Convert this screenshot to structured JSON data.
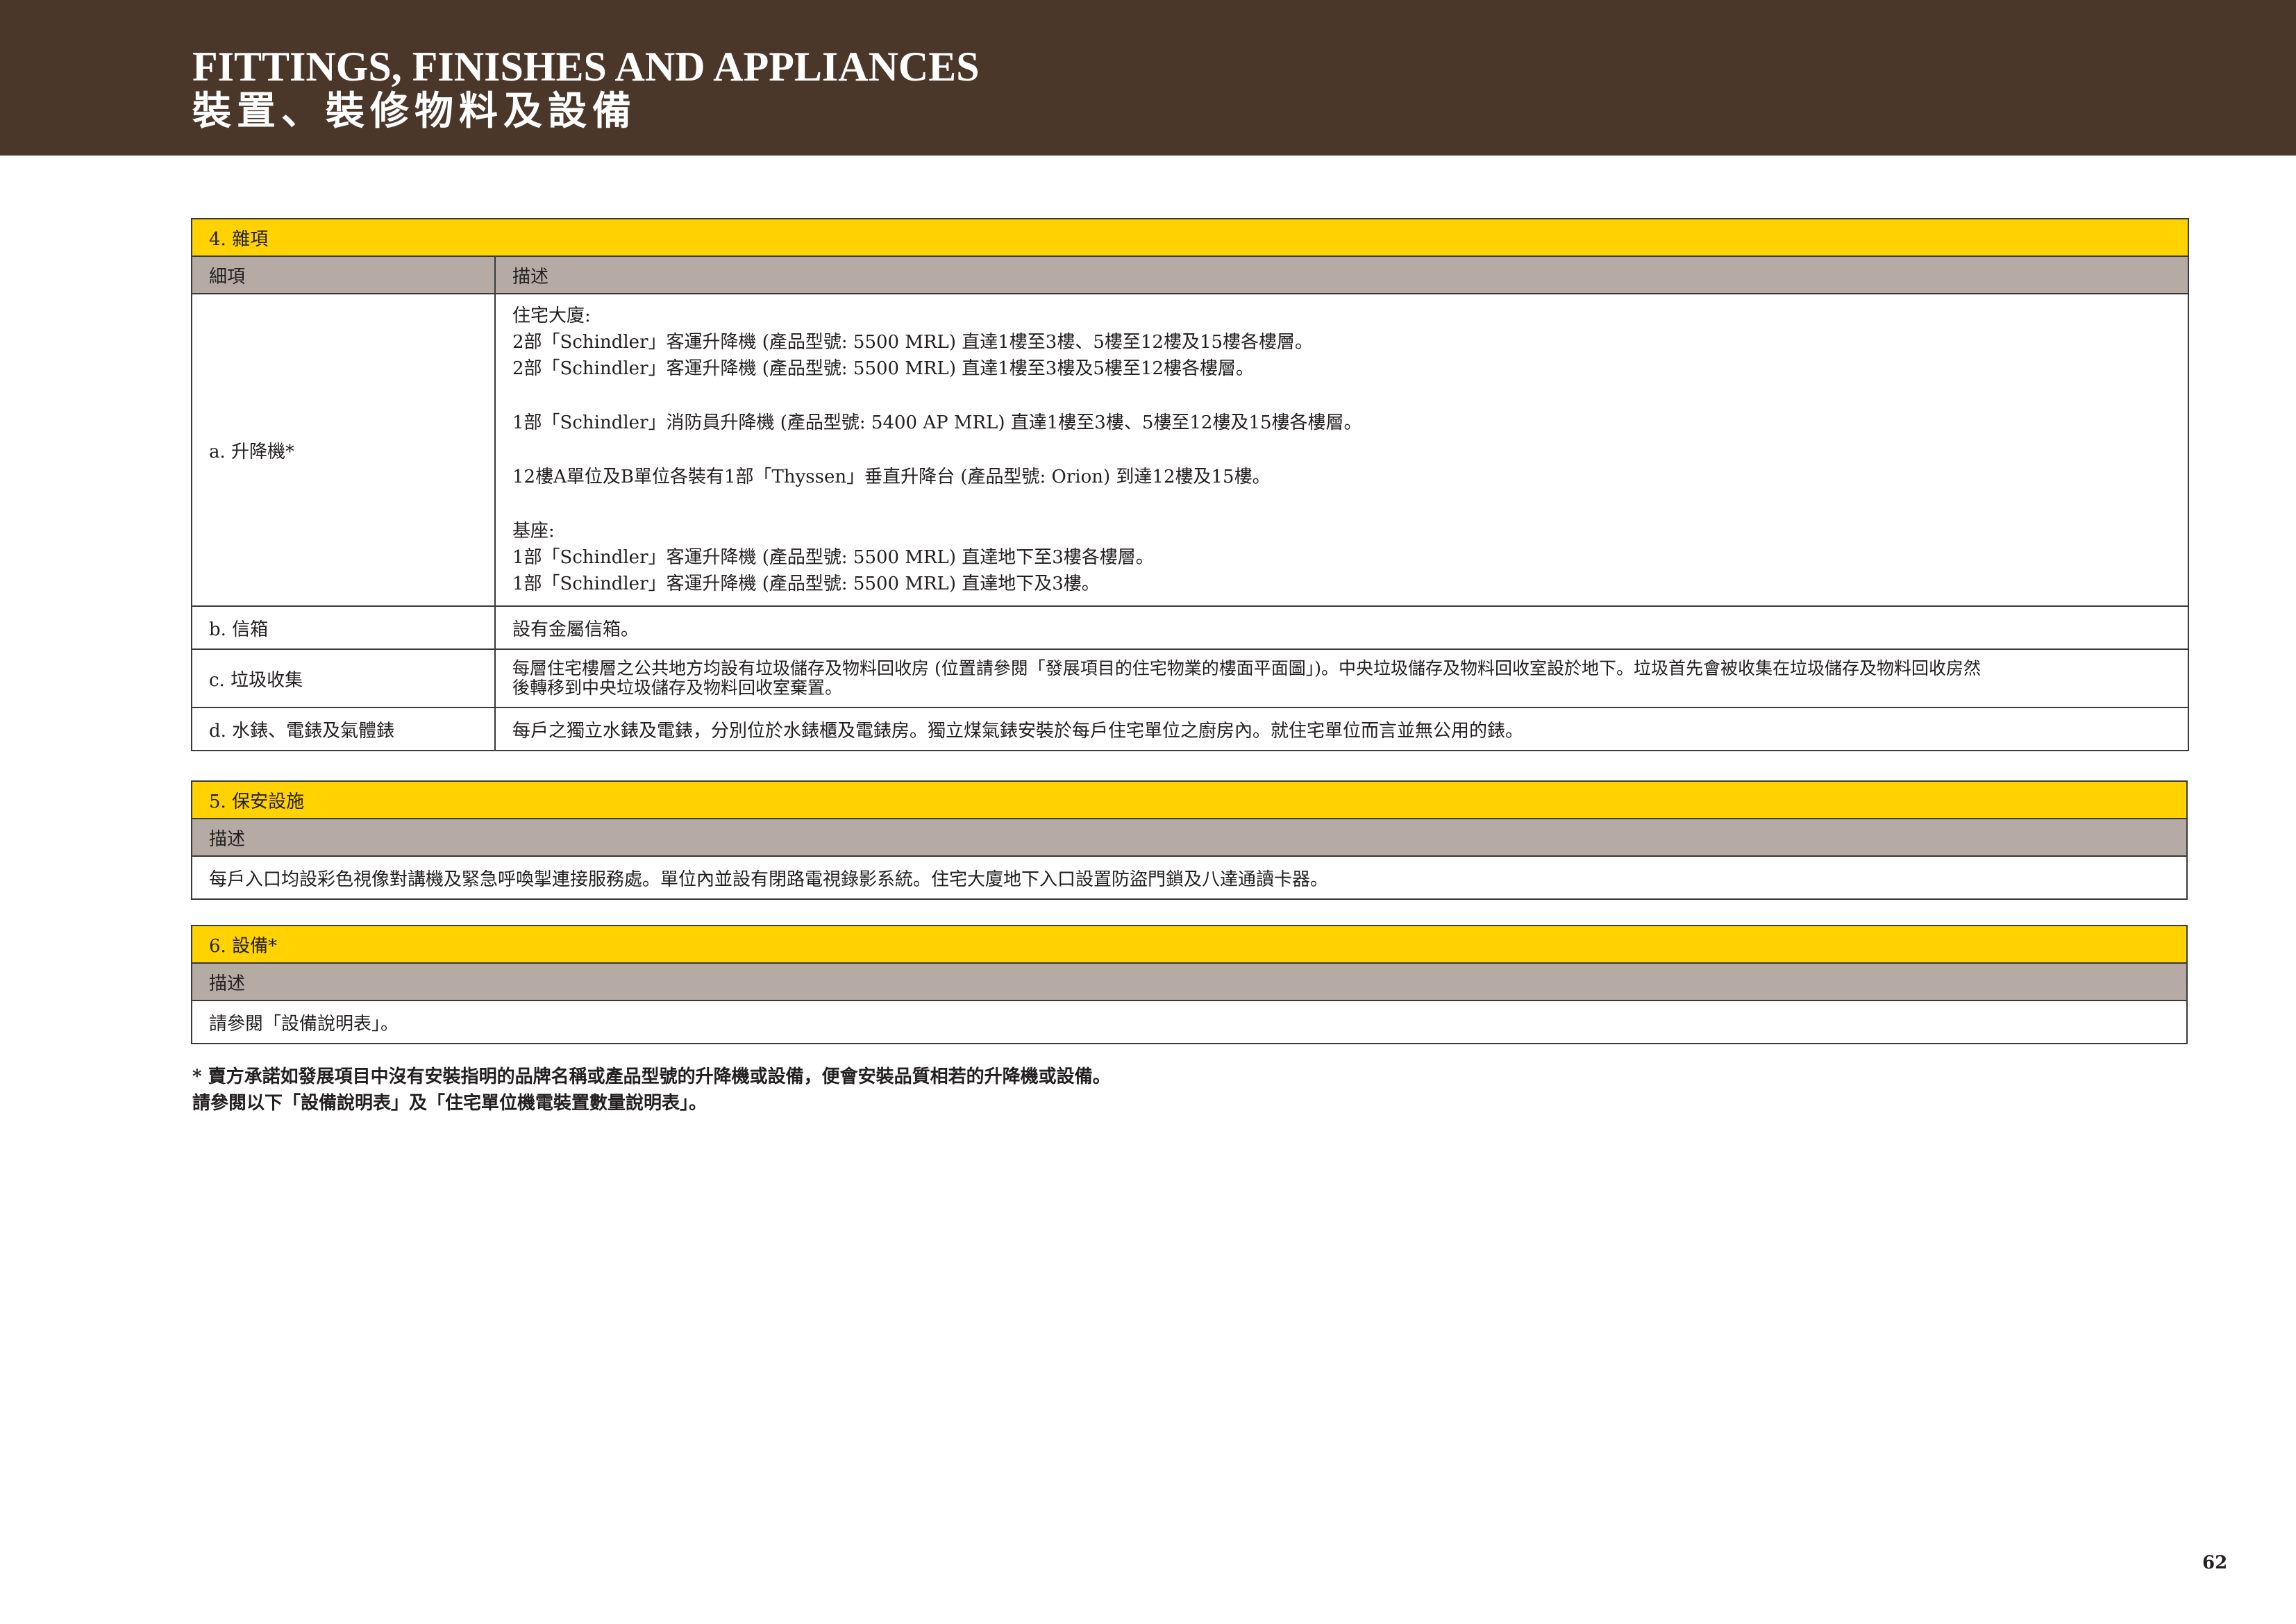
{
  "header": {
    "title_en": "FITTINGS, FINISHES AND APPLIANCES",
    "title_zh": "裝置、裝修物料及設備"
  },
  "section4": {
    "title": "4.  雜項",
    "col_item": "細項",
    "col_desc": "描述",
    "rows": [
      {
        "item": "a.  升降機*",
        "lines": [
          "住宅大廈:",
          "2部「Schindler」客運升降機 (產品型號: 5500 MRL) 直達1樓至3樓、5樓至12樓及15樓各樓層。",
          "2部「Schindler」客運升降機 (產品型號: 5500 MRL) 直達1樓至3樓及5樓至12樓各樓層。",
          "",
          "1部「Schindler」消防員升降機 (產品型號: 5400 AP MRL) 直達1樓至3樓、5樓至12樓及15樓各樓層。",
          "",
          "12樓A單位及B單位各裝有1部「Thyssen」垂直升降台 (產品型號: Orion) 到達12樓及15樓。",
          "",
          "基座:",
          "1部「Schindler」客運升降機 (產品型號: 5500 MRL) 直達地下至3樓各樓層。",
          "1部「Schindler」客運升降機 (產品型號: 5500 MRL) 直達地下及3樓。"
        ]
      },
      {
        "item": "b.  信箱",
        "lines": [
          "設有金屬信箱。"
        ]
      },
      {
        "item": "c.  垃圾收集",
        "lines": [
          "每層住宅樓層之公共地方均設有垃圾儲存及物料回收房 (位置請參閱「發展項目的住宅物業的樓面平面圖」)。中央垃圾儲存及物料回收室設於地下。垃圾首先會被收集在垃圾儲存及物料回收房然",
          "後轉移到中央垃圾儲存及物料回收室棄置。"
        ]
      },
      {
        "item": "d.  水錶、電錶及氣體錶",
        "lines": [
          "每戶之獨立水錶及電錶，分別位於水錶櫃及電錶房。獨立煤氣錶安裝於每戶住宅單位之廚房內。就住宅單位而言並無公用的錶。"
        ]
      }
    ]
  },
  "section5": {
    "title": "5.  保安設施",
    "col_desc": "描述",
    "desc": "每戶入口均設彩色視像對講機及緊急呼喚掣連接服務處。單位內並設有閉路電視錄影系統。住宅大廈地下入口設置防盜門鎖及八達通讀卡器。"
  },
  "section6": {
    "title": "6.  設備*",
    "col_desc": "描述",
    "desc": "請參閱「設備說明表」。"
  },
  "footnotes": [
    "* 賣方承諾如發展項目中沒有安裝指明的品牌名稱或產品型號的升降機或設備，便會安裝品質相若的升降機或設備。",
    "請參閱以下「設備說明表」及「住宅單位機電裝置數量說明表」。"
  ],
  "page_number": "62"
}
